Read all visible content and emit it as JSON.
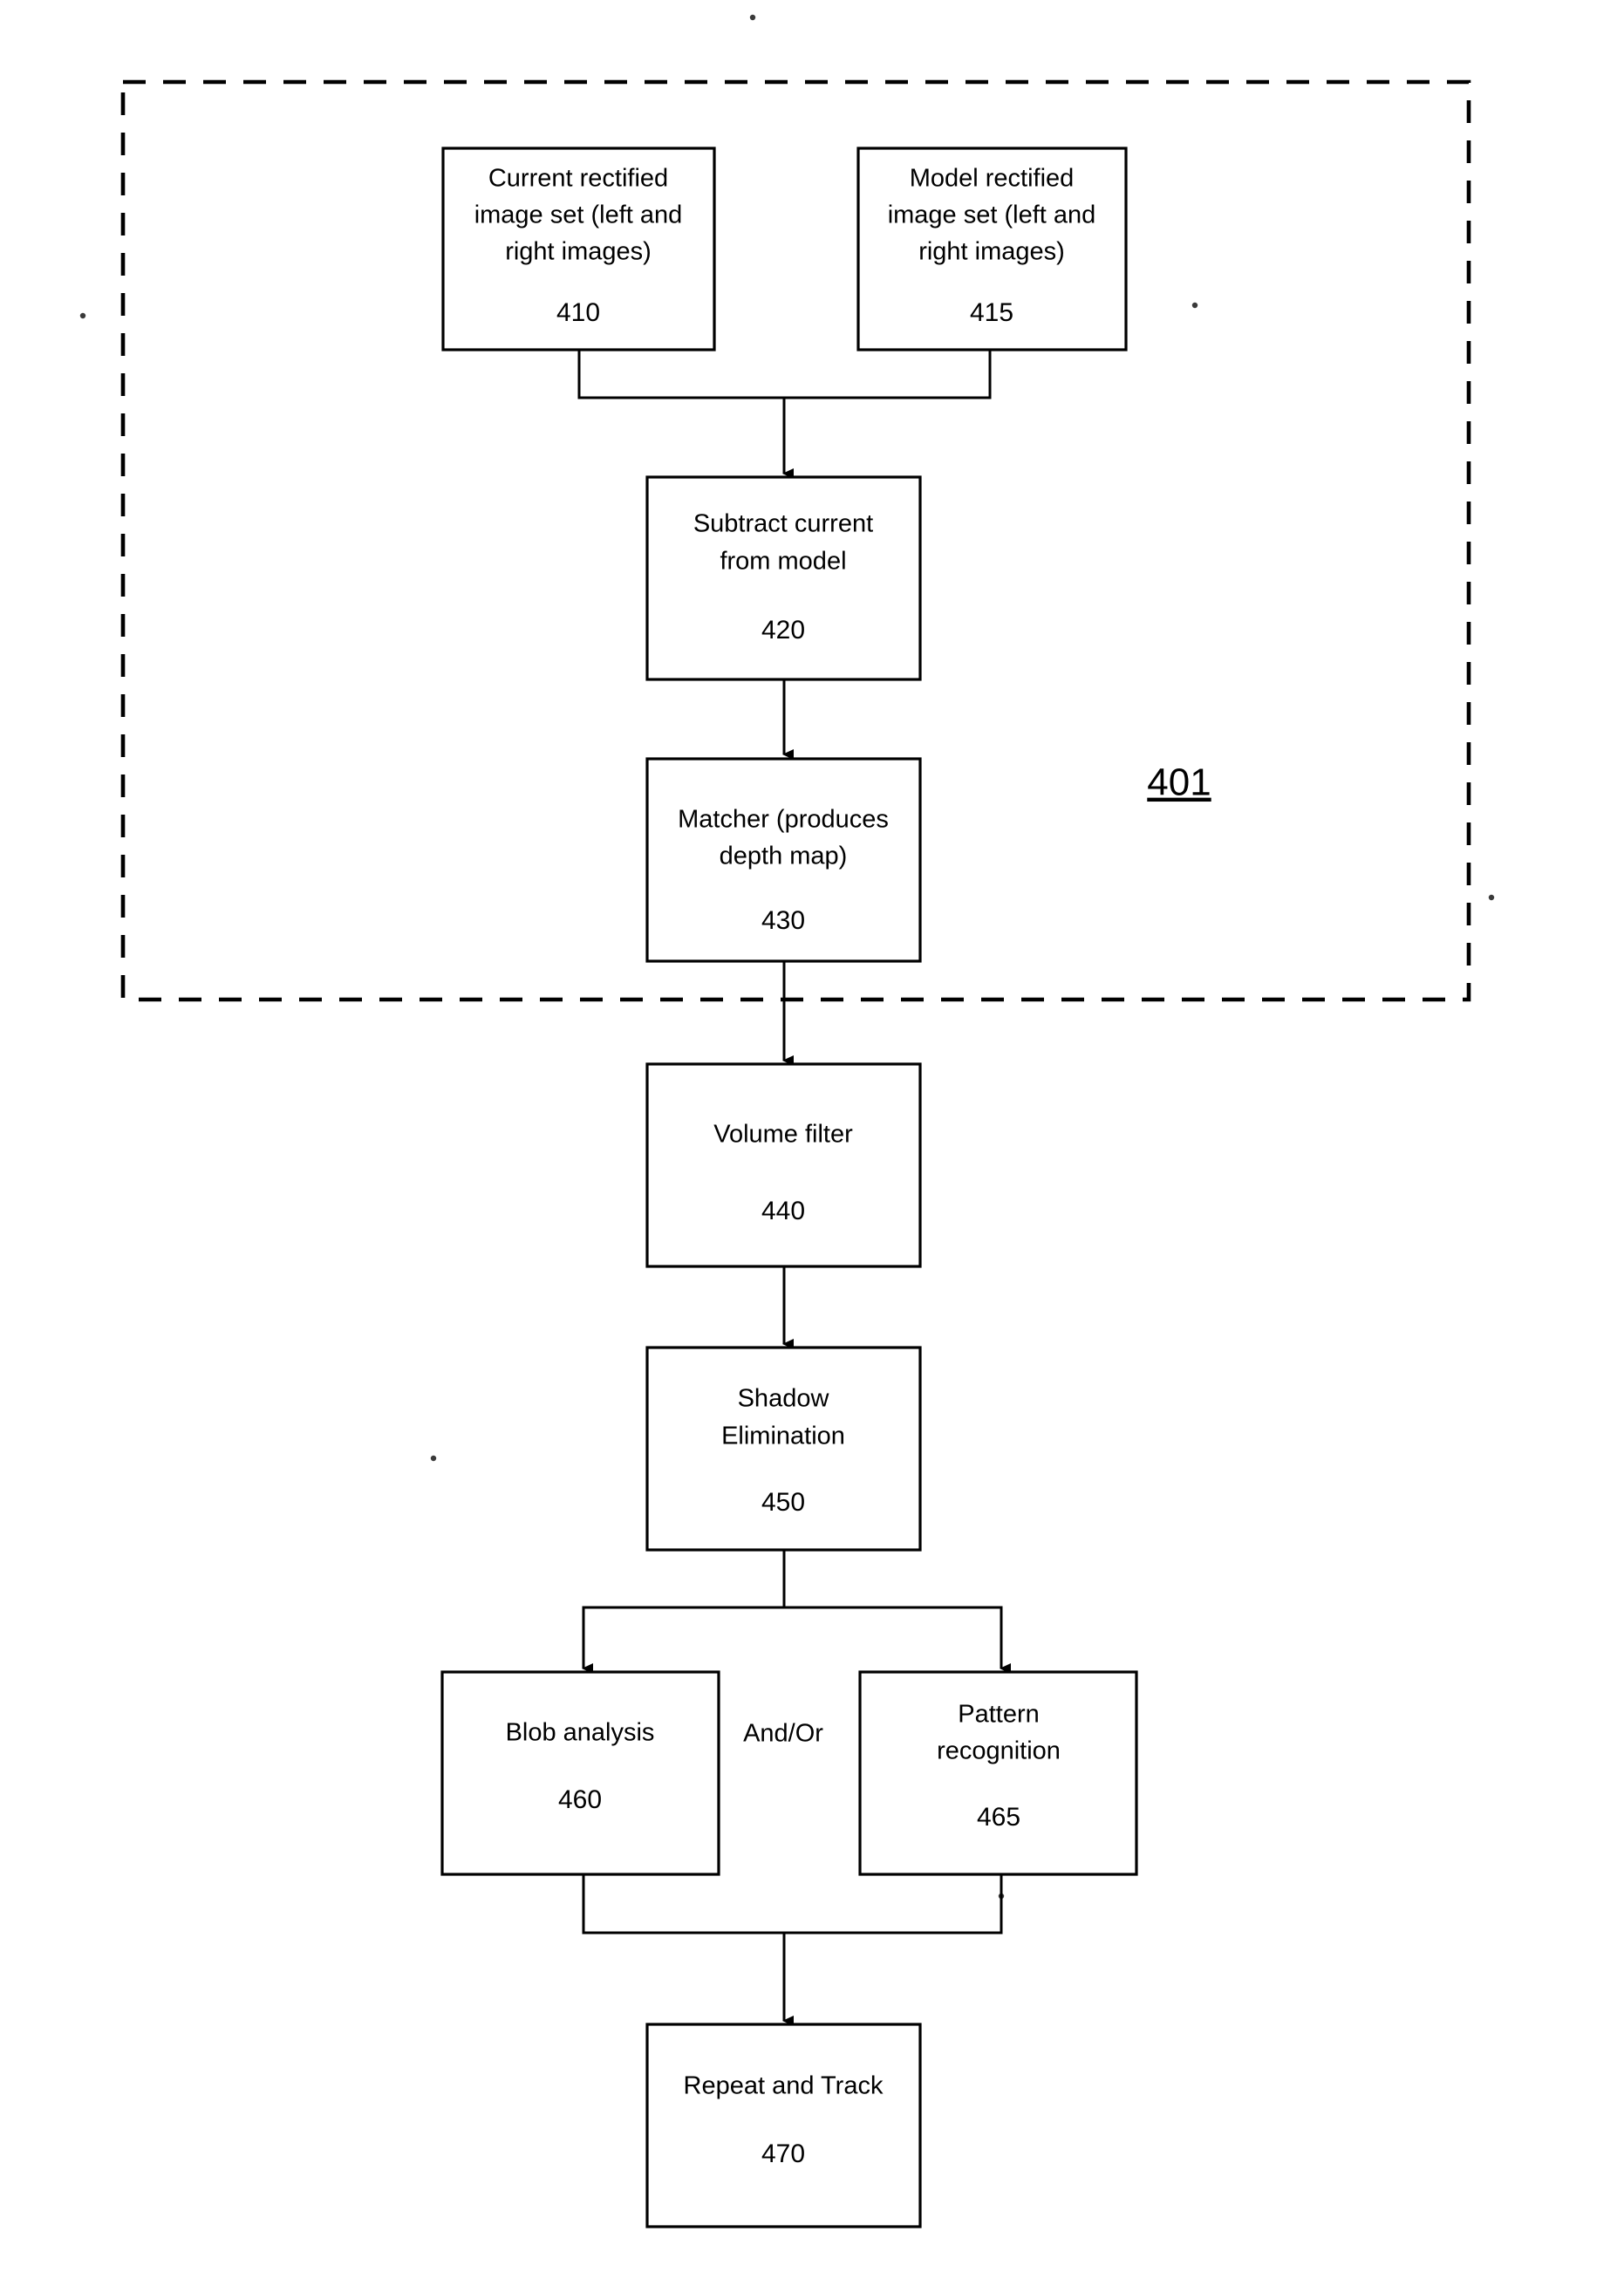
{
  "figure": {
    "group_label": "401",
    "edge_labels": {
      "and_or": "And/Or"
    },
    "nodes": [
      {
        "id": "n410",
        "ref": "410",
        "lines": [
          "Current rectified",
          "image set (left and",
          "right images)"
        ]
      },
      {
        "id": "n415",
        "ref": "415",
        "lines": [
          "Model rectified",
          "image set (left and",
          "right images)"
        ]
      },
      {
        "id": "n420",
        "ref": "420",
        "lines": [
          "Subtract current",
          "from model"
        ]
      },
      {
        "id": "n430",
        "ref": "430",
        "lines": [
          "Matcher (produces",
          "depth map)"
        ]
      },
      {
        "id": "n440",
        "ref": "440",
        "lines": [
          "Volume filter"
        ]
      },
      {
        "id": "n450",
        "ref": "450",
        "lines": [
          "Shadow",
          "Elimination"
        ]
      },
      {
        "id": "n460",
        "ref": "460",
        "lines": [
          "Blob analysis"
        ]
      },
      {
        "id": "n465",
        "ref": "465",
        "lines": [
          "Pattern",
          "recognition"
        ]
      },
      {
        "id": "n470",
        "ref": "470",
        "lines": [
          "Repeat and Track"
        ]
      }
    ],
    "colors": {
      "stroke": "#000000",
      "fill": "#ffffff"
    }
  }
}
